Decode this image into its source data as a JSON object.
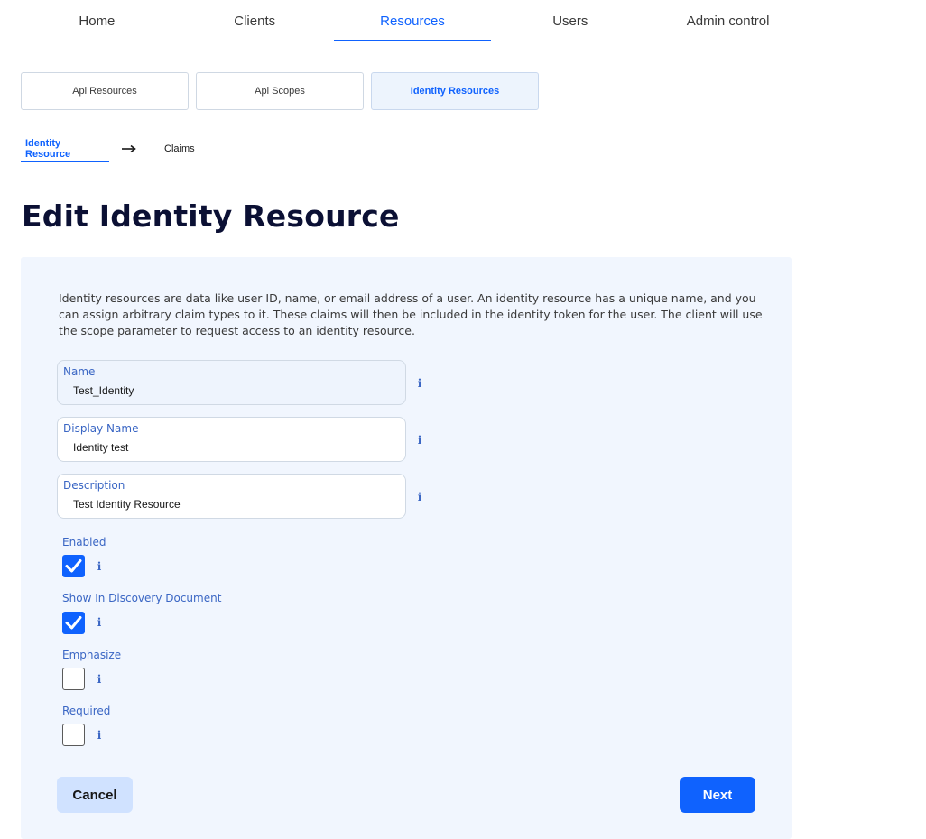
{
  "nav": {
    "items": [
      {
        "label": "Home"
      },
      {
        "label": "Clients"
      },
      {
        "label": "Resources"
      },
      {
        "label": "Users"
      },
      {
        "label": "Admin control"
      }
    ],
    "active": "Resources"
  },
  "subtabs": {
    "items": [
      {
        "label": "Api Resources"
      },
      {
        "label": "Api Scopes"
      },
      {
        "label": "Identity Resources"
      }
    ],
    "active": "Identity Resources"
  },
  "steps": {
    "items": [
      {
        "label": "Identity Resource"
      },
      {
        "label": "Claims"
      }
    ],
    "active": "Identity Resource",
    "separator_icon": "arrow-right-icon"
  },
  "page": {
    "title": "Edit Identity Resource",
    "intro": "Identity resources are data like user ID, name, or email address of a user. An identity resource has a unique name, and you can assign arbitrary claim types to it. These claims will then be included in the identity token for the user. The client will use the scope parameter to request access to an identity resource."
  },
  "form": {
    "fields": [
      {
        "label": "Name",
        "value": "Test_Identity"
      },
      {
        "label": "Display Name",
        "value": "Identity test"
      },
      {
        "label": "Description",
        "value": "Test Identity Resource"
      }
    ],
    "checkboxes": [
      {
        "label": "Enabled",
        "checked": true
      },
      {
        "label": "Show In Discovery Document",
        "checked": true
      },
      {
        "label": "Emphasize",
        "checked": false
      },
      {
        "label": "Required",
        "checked": false
      }
    ],
    "info_glyph": "i",
    "cancel_label": "Cancel",
    "next_label": "Next"
  },
  "colors": {
    "accent": "#0f62fe",
    "card_background": "#f1f6fe",
    "title": "#0b1034",
    "label": "#3a66c4"
  }
}
